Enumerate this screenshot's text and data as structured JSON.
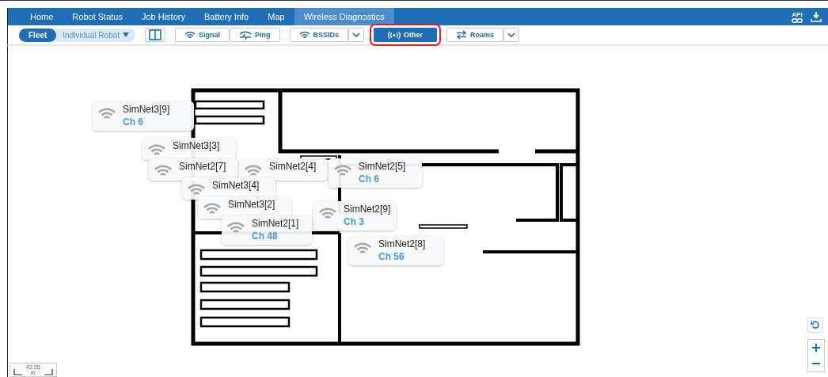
{
  "nav": {
    "tabs": [
      {
        "label": "Home",
        "selected": false
      },
      {
        "label": "Robot Status",
        "selected": false
      },
      {
        "label": "Job History",
        "selected": false
      },
      {
        "label": "Battery Info",
        "selected": false
      },
      {
        "label": "Map",
        "selected": false
      },
      {
        "label": "Wireless Diagnostics",
        "selected": true
      }
    ],
    "api_label": "API"
  },
  "toolbar": {
    "scope": [
      {
        "label": "Fleet",
        "selected": true
      },
      {
        "label": "Individual Robot",
        "selected": false
      }
    ],
    "groups": [
      [
        {
          "label": "Signal",
          "kind": "wifi",
          "selected": false
        },
        {
          "label": "Ping",
          "kind": "pulse",
          "selected": false
        }
      ],
      [
        {
          "label": "BSSIDs",
          "kind": "wifi",
          "selected": false
        },
        {
          "kind": "dropdown"
        }
      ],
      [
        {
          "label": "Other",
          "kind": "broadcast",
          "selected": true
        }
      ],
      [
        {
          "label": "Roams",
          "kind": "swap",
          "selected": false
        },
        {
          "kind": "dropdown"
        }
      ]
    ]
  },
  "map": {
    "access_points": [
      {
        "name": "SimNet3[9]",
        "channel": "Ch 6"
      },
      {
        "name": "SimNet3[3]"
      },
      {
        "name": "SimNet2[7]"
      },
      {
        "name": "SimNet2[4]"
      },
      {
        "name": "SimNet2[5]",
        "channel": "Ch 6"
      },
      {
        "name": "SimNet3[4]"
      },
      {
        "name": "SimNet3[2]"
      },
      {
        "name": "SimNet2[9]",
        "channel": "Ch 3"
      },
      {
        "name": "SimNet2[1]",
        "channel": "Ch 48"
      },
      {
        "name": "SimNet2[8]",
        "channel": "Ch 56"
      }
    ],
    "scale": {
      "value": "42.25",
      "unit": "m"
    }
  }
}
